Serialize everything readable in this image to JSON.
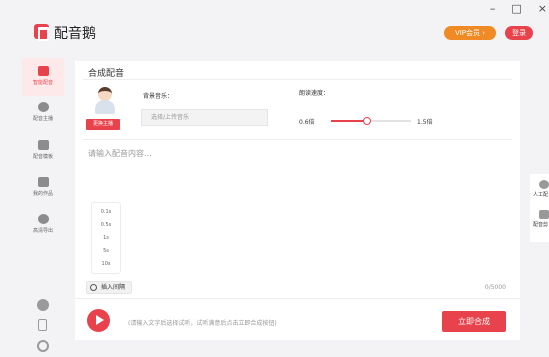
{
  "window": {
    "minimize": "–",
    "maximize": "□",
    "close": "×"
  },
  "app": {
    "title": "配音鹅",
    "vip_label": "VIP会员 ›",
    "login_label": "登录"
  },
  "sidebar": {
    "items": [
      {
        "label": "智能配音",
        "active": true
      },
      {
        "label": "配音主播"
      },
      {
        "label": "配音模板"
      },
      {
        "label": "我的作品"
      },
      {
        "label": "高清导出"
      }
    ]
  },
  "main": {
    "section_title": "合成配音",
    "change_anchor_label": "更换主播",
    "bgm": {
      "label": "背景音乐：",
      "placeholder": "选择/上传音乐"
    },
    "speed": {
      "label": "朗读速度：",
      "min": "0.6倍",
      "max": "1.5倍",
      "value_fraction": 0.45
    },
    "text_placeholder": "请输入配音内容...",
    "pause_options": [
      "0.1s",
      "0.5s",
      "1s",
      "5s",
      "10s"
    ],
    "insert_pause_label": "插入间隔",
    "char_count": "0/5000",
    "hint": "(请输入文字后选择试听，试听满意后点击立即合成按钮)",
    "synthesize_label": "立即合成"
  },
  "float_panel": {
    "items": [
      "人工配",
      "配音剪"
    ]
  }
}
